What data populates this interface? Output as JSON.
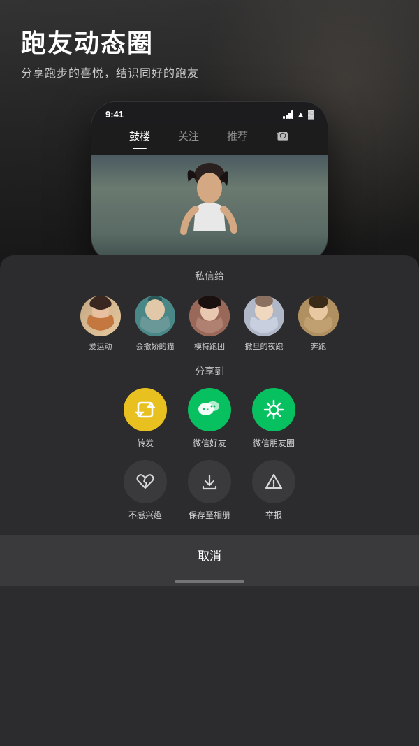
{
  "background": {
    "color": "#1a1a1a"
  },
  "header": {
    "title": "跑友动态圈",
    "subtitle": "分享跑步的喜悦，结识同好的跑友"
  },
  "phone": {
    "time": "9:41",
    "tabs": [
      {
        "label": "鼓楼",
        "active": true
      },
      {
        "label": "关注",
        "active": false
      },
      {
        "label": "推荐",
        "active": false
      }
    ]
  },
  "action_sheet": {
    "private_message_title": "私信给",
    "contacts": [
      {
        "name": "爱运动",
        "avatar_color": "#c4905a"
      },
      {
        "name": "会撒娇的猫",
        "avatar_color": "#4a8888"
      },
      {
        "name": "模特跑团",
        "avatar_color": "#9a6858"
      },
      {
        "name": "撒旦的夜跑",
        "avatar_color": "#a8b0c0"
      },
      {
        "name": "奔跑",
        "avatar_color": "#b09060"
      }
    ],
    "share_title": "分享到",
    "share_items": [
      {
        "label": "转发",
        "icon": "repost",
        "bg_color": "#e8c020"
      },
      {
        "label": "微信好友",
        "icon": "wechat",
        "bg_color": "#07c160"
      },
      {
        "label": "微信朋友圈",
        "icon": "moments",
        "bg_color": "#07c160"
      }
    ],
    "extra_items": [
      {
        "label": "不感兴趣",
        "icon": "heart-broken"
      },
      {
        "label": "保存至相册",
        "icon": "download"
      },
      {
        "label": "举报",
        "icon": "warning"
      }
    ],
    "cancel_label": "取消"
  }
}
